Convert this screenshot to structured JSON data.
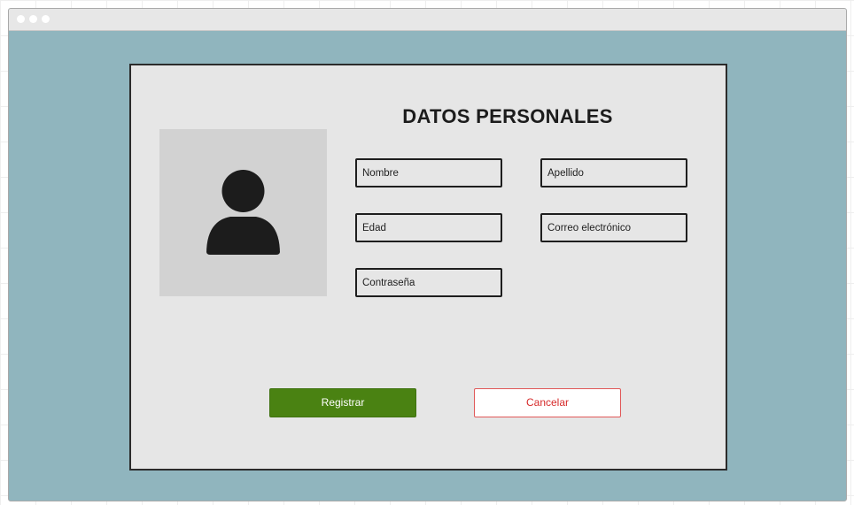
{
  "window": {
    "controls": [
      "window-dot-1",
      "window-dot-2",
      "window-dot-3"
    ]
  },
  "form": {
    "title": "DATOS PERSONALES",
    "avatar_icon": "user-icon",
    "fields": {
      "nombre": {
        "placeholder": "Nombre",
        "value": ""
      },
      "apellido": {
        "placeholder": "Apellido",
        "value": ""
      },
      "edad": {
        "placeholder": "Edad",
        "value": ""
      },
      "correo": {
        "placeholder": "Correo electrónico",
        "value": ""
      },
      "contrasena": {
        "placeholder": "Contraseña",
        "value": ""
      }
    },
    "buttons": {
      "registrar": "Registrar",
      "cancelar": "Cancelar"
    }
  },
  "colors": {
    "window_background": "#90b5be",
    "panel_background": "#e6e6e6",
    "primary_button": "#4a8212",
    "cancel_text": "#d62b2b"
  }
}
